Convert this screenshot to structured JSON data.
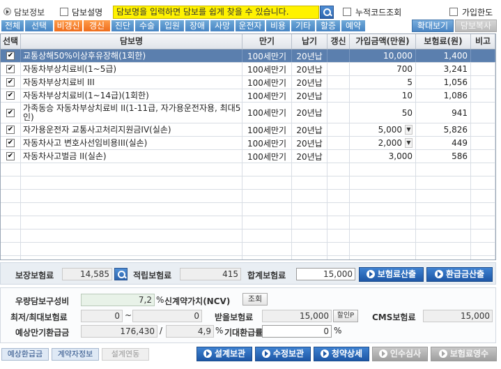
{
  "header": {
    "title": "담보정보",
    "checkbox_desc": "담보설명",
    "search_placeholder": "담보명을 입력하면 담보를 쉽게 찾을 수 있습니다.",
    "cumulative_code": "누적코드조회",
    "join_limit": "가입한도"
  },
  "tabs": [
    "전체",
    "선택",
    "비갱신",
    "갱신",
    "진단",
    "수술",
    "입원",
    "장애",
    "사망",
    "운전자",
    "비용",
    "기타",
    "할증",
    "예약"
  ],
  "active_tabs": [
    "비갱신",
    "갱신"
  ],
  "toolbar": {
    "zoom": "확대보기",
    "copy": "담보복사"
  },
  "grid": {
    "columns": [
      "선택",
      "담보명",
      "만기",
      "납기",
      "갱신",
      "가입금액(만원)",
      "보험료(원)",
      "비고"
    ],
    "rows": [
      {
        "checked": true,
        "name": "교통상해50%이상후유장해(1회한)",
        "maturity": "100세만기",
        "payment": "20년납",
        "renewal": "",
        "amount": "10,000",
        "dropdown": false,
        "premium": "1,400",
        "note": "",
        "selected": true
      },
      {
        "checked": true,
        "name": "자동차부상치료비(1~5급)",
        "maturity": "100세만기",
        "payment": "20년납",
        "renewal": "",
        "amount": "700",
        "dropdown": false,
        "premium": "3,241",
        "note": ""
      },
      {
        "checked": true,
        "name": "자동차부상치료비 III",
        "maturity": "100세만기",
        "payment": "20년납",
        "renewal": "",
        "amount": "5",
        "dropdown": false,
        "premium": "1,056",
        "note": ""
      },
      {
        "checked": true,
        "name": "자동차부상치료비(1~14급)(1회한)",
        "maturity": "100세만기",
        "payment": "20년납",
        "renewal": "",
        "amount": "10",
        "dropdown": false,
        "premium": "1,086",
        "note": ""
      },
      {
        "checked": true,
        "name": "가족동승 자동차부상치료비 II(1-11급, 자가용운전자용, 최대5인)",
        "maturity": "100세만기",
        "payment": "20년납",
        "renewal": "",
        "amount": "50",
        "dropdown": false,
        "premium": "941",
        "note": ""
      },
      {
        "checked": true,
        "name": "자가용운전자 교통사고처리지원금IV(실손)",
        "maturity": "100세만기",
        "payment": "20년납",
        "renewal": "",
        "amount": "5,000",
        "dropdown": true,
        "premium": "5,826",
        "note": ""
      },
      {
        "checked": true,
        "name": "자동차사고 변호사선임비용III(실손)",
        "maturity": "100세만기",
        "payment": "20년납",
        "renewal": "",
        "amount": "2,000",
        "dropdown": true,
        "premium": "449",
        "note": ""
      },
      {
        "checked": true,
        "name": "자동차사고벌금 II(실손)",
        "maturity": "100세만기",
        "payment": "20년납",
        "renewal": "",
        "amount": "3,000",
        "dropdown": false,
        "premium": "586",
        "note": ""
      }
    ]
  },
  "summary": {
    "guarantee_label": "보장보험료",
    "guarantee_value": "14,585",
    "accumulate_label": "적립보험료",
    "accumulate_value": "415",
    "total_label": "합계보험료",
    "total_value": "15,000",
    "calc_premium_btn": "보험료산출",
    "calc_refund_btn": "환급금산출"
  },
  "detail": {
    "quality_label": "우량담보구성비",
    "quality_value": "7,2",
    "quality_unit": "%",
    "ncv_label": "신계약가치(NCV)",
    "ncv_btn": "조회",
    "minmax_label": "최저/최대보험료",
    "min_value": "0",
    "tilde": "~",
    "max_value": "0",
    "receive_label": "받을보험료",
    "receive_value": "15,000",
    "discount_btn": "할인P",
    "cms_label": "CMS보험료",
    "cms_value": "15,000",
    "expected_label": "예상만기환급금",
    "expected_value": "176,430",
    "slash": "/",
    "expected_rate": "4,9",
    "expected_unit": "%",
    "refund_rate_label": "기대환급률",
    "refund_rate_value": "0",
    "refund_rate_unit": "%"
  },
  "bottom": {
    "tabs": [
      "예상환급금",
      "계약자정보",
      "설계연동"
    ],
    "buttons": [
      "설계보관",
      "수정보관",
      "청약상세",
      "인수심사",
      "보험료영수"
    ]
  },
  "colors": {
    "accent_blue": "#1d57a6",
    "tab_blue": "#4785c4",
    "tab_orange": "#ef6d1c",
    "search_yellow": "#fff200",
    "row_selected": "#5b7fae"
  }
}
